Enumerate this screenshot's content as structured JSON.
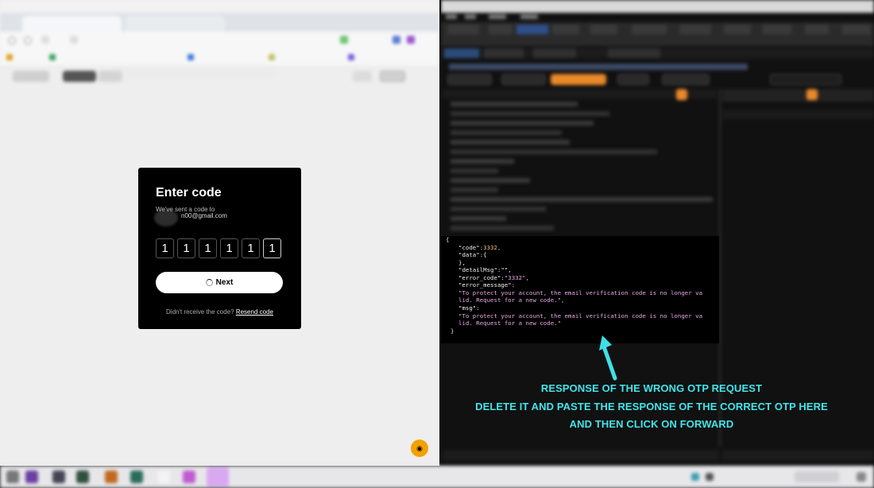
{
  "modal": {
    "title": "Enter code",
    "subtitle": "We've sent a code to",
    "email": "n00@gmail.com",
    "digits": [
      "1",
      "1",
      "1",
      "1",
      "1",
      "1"
    ],
    "next_label": "Next",
    "resend_prompt": "Didn't receive the code?",
    "resend_link": "Resend code"
  },
  "response": {
    "open_brace": "{",
    "code_key": "\"code\":",
    "code_val": "3332,",
    "data_line": "\"data\":{",
    "data_close": "},",
    "detail_line": "\"detailMsg\":\"\",",
    "error_code_key": "\"error_code\":",
    "error_code_val": "\"3332\",",
    "error_message_key": "\"error_message\":",
    "error_message_l1": "\"To protect your account, the email verification code is no longer va",
    "error_message_l2": "lid. Request for a new code.\",",
    "msg_key": "\"msg\":",
    "msg_l1": "\"To protect your account, the email verification code is no longer va",
    "msg_l2": "lid. Request for a new code.\"",
    "close_brace": "}"
  },
  "annotation": {
    "line1": "RESPONSE OF THE WRONG OTP REQUEST",
    "line2": "DELETE IT AND PASTE THE RESPONSE OF THE CORRECT OTP HERE",
    "line3": "AND THEN CLICK ON FORWARD"
  },
  "colors": {
    "annotation": "#41e6ec",
    "burp_accent": "#e8892a",
    "json_number": "#e6c27a",
    "json_string": "#e9a6e9"
  },
  "icons": [
    "loading-spinner-icon",
    "hand-drawn-arrow-icon",
    "chat-bubble-icon"
  ]
}
